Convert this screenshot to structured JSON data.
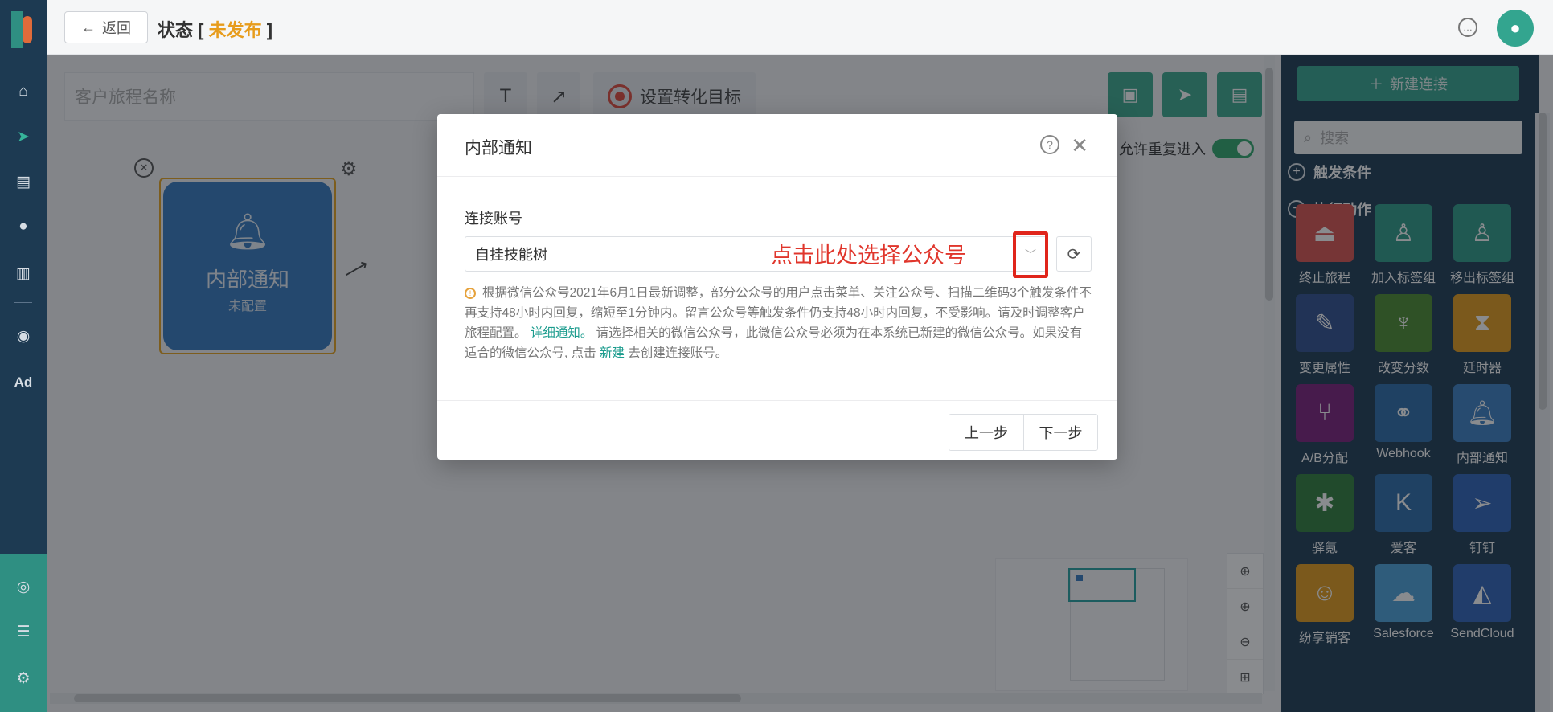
{
  "topbar": {
    "back_label": "返回",
    "status_prefix": "状态 [",
    "status_value": "未发布",
    "status_suffix": "]"
  },
  "toolbar": {
    "name_placeholder": "客户旅程名称",
    "text_tool": "T",
    "arrow_tool": "↗",
    "goal_label": "设置转化目标",
    "repeat_label": "允许重复进入",
    "repeat_enabled": true
  },
  "canvas": {
    "node_title": "内部通知",
    "node_status": "未配置"
  },
  "right_panel": {
    "new_connection": "新建连接",
    "search_placeholder": "搜索",
    "section_trigger": "触发条件",
    "section_action": "执行动作",
    "actions": [
      {
        "label": "终止旅程",
        "icon": "eject-icon",
        "color": "#d9534f"
      },
      {
        "label": "加入标签组",
        "icon": "user-plus-icon",
        "color": "#2d9b87"
      },
      {
        "label": "移出标签组",
        "icon": "user-minus-icon",
        "color": "#2d9b87"
      },
      {
        "label": "变更属性",
        "icon": "edit-icon",
        "color": "#2f4f8f"
      },
      {
        "label": "改变分数",
        "icon": "trophy-icon",
        "color": "#4a8b2e"
      },
      {
        "label": "延时器",
        "icon": "hourglass-icon",
        "color": "#e39a1b"
      },
      {
        "label": "A/B分配",
        "icon": "branch-icon",
        "color": "#7a1f7a"
      },
      {
        "label": "Webhook",
        "icon": "webhook-icon",
        "color": "#2a6aa8"
      },
      {
        "label": "内部通知",
        "icon": "bell-icon",
        "color": "#3a7fc2"
      },
      {
        "label": "驿氪",
        "icon": "spider-icon",
        "color": "#2e7d3a"
      },
      {
        "label": "爱客",
        "icon": "k-icon",
        "color": "#2a6aa8"
      },
      {
        "label": "钉钉",
        "icon": "dingtalk-icon",
        "color": "#2d62b8"
      },
      {
        "label": "纷享销客",
        "icon": "fxiaoke-icon",
        "color": "#e39a1b"
      },
      {
        "label": "Salesforce",
        "icon": "cloud-icon",
        "color": "#4aa0d8"
      },
      {
        "label": "SendCloud",
        "icon": "sendcloud-icon",
        "color": "#2f62b8"
      }
    ]
  },
  "dialog": {
    "title": "内部通知",
    "field_label": "连接账号",
    "selected_account": "自挂技能树",
    "annotation": "点击此处选择公众号",
    "notice_main": "根据微信公众号2021年6月1日最新调整，部分公众号的用户点击菜单、关注公众号、扫描二维码3个触发条件不再支持48小时内回复，缩短至1分钟内。留言公众号等触发条件仍支持48小时内回复，不受影响。请及时调整客户旅程配置。",
    "notice_link": "详细通知。",
    "notice_mid": "请选择相关的微信公众号，此微信公众号必须为在本系统已新建的微信公众号。如果没有适合的微信公众号, 点击",
    "notice_new": "新建",
    "notice_end": "去创建连接账号。",
    "prev_button": "上一步",
    "next_button": "下一步"
  }
}
